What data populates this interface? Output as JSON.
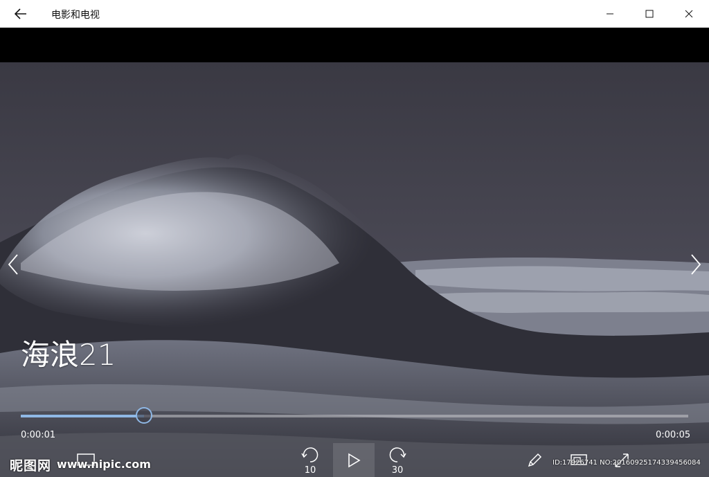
{
  "window": {
    "title": "电影和电视",
    "icons": {
      "back": "back-arrow-icon",
      "minimize": "minimize-icon",
      "maximize": "maximize-icon",
      "close": "close-icon"
    }
  },
  "player": {
    "video_title": "海浪21",
    "current_time": "0:00:01",
    "total_time": "0:00:05",
    "progress": 0.185,
    "accent_color": "#8fb8e6",
    "skip_back_label": "10",
    "skip_forward_label": "30",
    "icons": {
      "prev": "chevron-left-icon",
      "next": "chevron-right-icon",
      "captions": "captions-icon",
      "skip_back": "skip-back-icon",
      "play": "play-icon",
      "skip_forward": "skip-forward-icon",
      "edit": "pencil-icon",
      "cast": "cast-to-device-icon",
      "resize": "mini-view-icon"
    }
  },
  "watermark": {
    "logo": "昵图网",
    "url": "www.nipic.com",
    "id_text": "ID:17926741 NO:20160925174339456084"
  }
}
